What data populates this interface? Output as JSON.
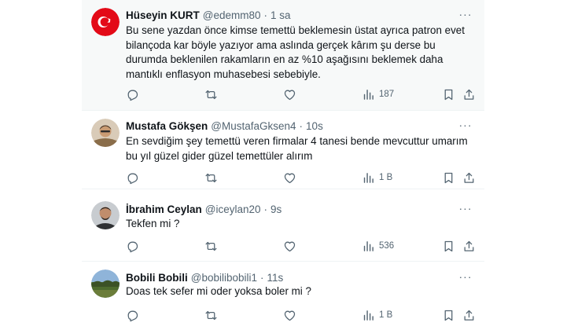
{
  "tweets": [
    {
      "name": "Hüseyin KURT",
      "handle": "@edemm80",
      "time": "1 sa",
      "text": "Bu sene yazdan önce kimse temettü beklemesin üstat ayrıca patron evet bilançoda kar böyle yazıyor ama aslında gerçek kârım şu derse bu durumda beklenilen rakamların en az %10 aşağısını beklemek daha mantıklı enflasyon muhasebesi sebebiyle.",
      "views": "187",
      "avatar_style": "turkish-flag"
    },
    {
      "name": "Mustafa Gökşen",
      "handle": "@MustafaGksen4",
      "time": "10s",
      "text": "En sevdiğim şey temettü veren firmalar 4 tanesi bende mevcuttur umarım bu yıl güzel gider güzel temettüler alırım",
      "views": "1 B",
      "avatar_style": "person-photo"
    },
    {
      "name": "İbrahim Ceylan",
      "handle": "@iceylan20",
      "time": "9s",
      "text": "Tekfen mi ?",
      "views": "536",
      "avatar_style": "person-photo"
    },
    {
      "name": "Bobili Bobili",
      "handle": "@bobilibobili1",
      "time": "11s",
      "text": "Doas tek sefer mi oder yoksa boler mi ?",
      "views": "1 B",
      "avatar_style": "landscape-photo"
    }
  ],
  "more_label": "···",
  "dot": "·",
  "icons": [
    "reply-icon",
    "retweet-icon",
    "like-icon",
    "views-icon",
    "bookmark-icon",
    "share-icon"
  ],
  "colors": {
    "text": "#0f1419",
    "muted": "#536471",
    "divider": "#eff3f4",
    "highlight": "#f7f9f9",
    "flag_red": "#e30a17"
  }
}
